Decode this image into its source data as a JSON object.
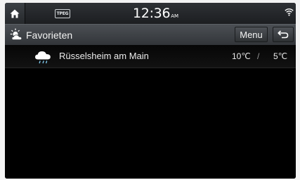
{
  "status_bar": {
    "home_icon": "home-icon",
    "tpeg_label": "TPEG",
    "time": "12:36",
    "ampm": "AM",
    "wifi_icon": "wifi-icon"
  },
  "header": {
    "icon": "sun-cloud-icon",
    "title": "Favorieten",
    "menu_label": "Menu",
    "back_icon": "back-arrow-icon"
  },
  "favorites": [
    {
      "weather_icon": "rain-cloud-icon",
      "city": "Rüsselsheim am Main",
      "temp_high": "10℃",
      "separator": "/",
      "temp_low": "5℃"
    }
  ],
  "colors": {
    "background": "#000000",
    "header_bar": "#3e4247",
    "status_bar": "#25282b",
    "text": "#ececec"
  }
}
